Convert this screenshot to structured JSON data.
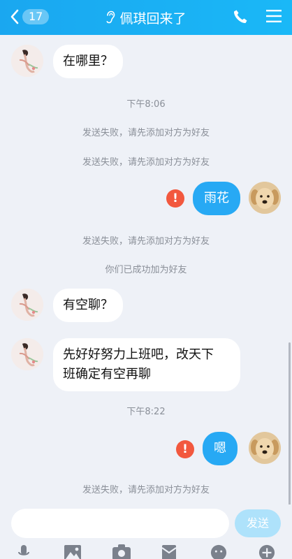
{
  "header": {
    "badge_count": "17",
    "title": "佩琪回来了",
    "back_icon": "chevron-left-icon",
    "phone_icon": "phone-icon",
    "menu_icon": "menu-icon"
  },
  "messages": [
    {
      "type": "incoming",
      "text": "在哪里？"
    },
    {
      "type": "time",
      "text": "下午8:06"
    },
    {
      "type": "system",
      "text": "发送失败，请先添加对方为好友"
    },
    {
      "type": "system",
      "text": "发送失败，请先添加对方为好友"
    },
    {
      "type": "outgoing",
      "text": "雨花",
      "status": "failed"
    },
    {
      "type": "system",
      "text": "发送失败，请先添加对方为好友"
    },
    {
      "type": "system",
      "text": "你们已成功加为好友"
    },
    {
      "type": "incoming",
      "text": "有空聊？"
    },
    {
      "type": "incoming",
      "text_line1": "先好好努力上班吧，改天下",
      "text_line2": "班确定有空再聊"
    },
    {
      "type": "time",
      "text": "下午8:22"
    },
    {
      "type": "outgoing",
      "text": "嗯",
      "status": "failed"
    },
    {
      "type": "system",
      "text": "发送失败，请先添加对方为好友"
    }
  ],
  "input": {
    "placeholder": "",
    "value": "",
    "send_label": "发送"
  },
  "toolbar": [
    "microphone-icon",
    "image-icon",
    "camera-icon",
    "red-packet-icon",
    "emoji-icon",
    "plus-icon"
  ],
  "colors": {
    "header": "#1aa7f0",
    "outgoing_bubble": "#27a9f4",
    "error": "#f2583e",
    "background": "#eef1f7"
  }
}
